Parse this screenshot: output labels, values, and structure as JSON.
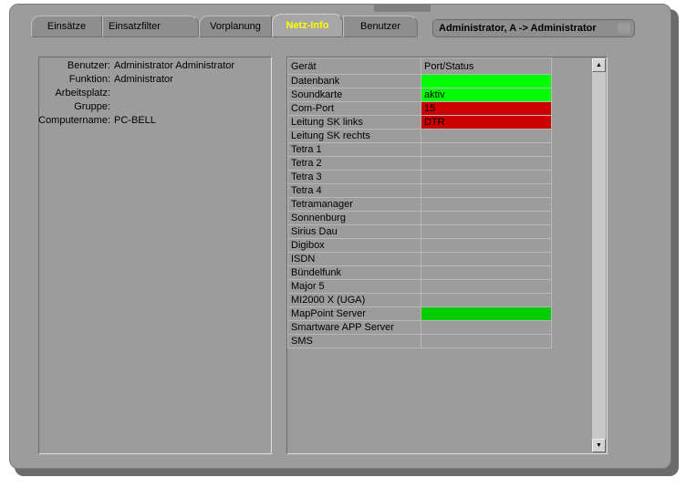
{
  "tabs": [
    {
      "label": "Einsätze",
      "active": false
    },
    {
      "label": "Einsatzfilter",
      "active": false
    },
    {
      "label": "Vorplanung",
      "active": false
    },
    {
      "label": "Netz-Info",
      "active": true
    },
    {
      "label": "Benutzer",
      "active": false
    }
  ],
  "user_box": {
    "text": "Administrator, A -> Administrator"
  },
  "info": [
    {
      "label": "Benutzer:",
      "value": "Administrator Administrator"
    },
    {
      "label": "Funktion:",
      "value": "Administrator"
    },
    {
      "label": "Arbeitsplatz:",
      "value": ""
    },
    {
      "label": "Gruppe:",
      "value": ""
    },
    {
      "label": "Computername:",
      "value": "PC-BELL"
    }
  ],
  "table": {
    "headers": [
      "Gerät",
      "Port/Status"
    ],
    "rows": [
      {
        "device": "Datenbank",
        "status": "",
        "color": "#00ff00"
      },
      {
        "device": "Soundkarte",
        "status": "aktiv",
        "color": "#00ff00"
      },
      {
        "device": "Com-Port",
        "status": "15",
        "color": "#cc0000"
      },
      {
        "device": "Leitung SK links",
        "status": "DTR",
        "color": "#cc0000"
      },
      {
        "device": "Leitung SK rechts",
        "status": "",
        "color": ""
      },
      {
        "device": "Tetra 1",
        "status": "",
        "color": ""
      },
      {
        "device": "Tetra 2",
        "status": "",
        "color": ""
      },
      {
        "device": "Tetra 3",
        "status": "",
        "color": ""
      },
      {
        "device": "Tetra 4",
        "status": "",
        "color": ""
      },
      {
        "device": "Tetramanager",
        "status": "",
        "color": ""
      },
      {
        "device": "Sonnenburg",
        "status": "",
        "color": ""
      },
      {
        "device": "Sirius Dau",
        "status": "",
        "color": ""
      },
      {
        "device": "Digibox",
        "status": "",
        "color": ""
      },
      {
        "device": "ISDN",
        "status": "",
        "color": ""
      },
      {
        "device": "Bündelfunk",
        "status": "",
        "color": ""
      },
      {
        "device": "Major 5",
        "status": "",
        "color": ""
      },
      {
        "device": "MI2000 X (UGA)",
        "status": "",
        "color": ""
      },
      {
        "device": "MapPoint Server",
        "status": "",
        "color": "#00cc00"
      },
      {
        "device": "Smartware APP Server",
        "status": "",
        "color": ""
      },
      {
        "device": "SMS",
        "status": "",
        "color": ""
      }
    ]
  },
  "scrollbar": {
    "up_icon": "triangle-up-icon",
    "down_icon": "triangle-down-icon"
  }
}
